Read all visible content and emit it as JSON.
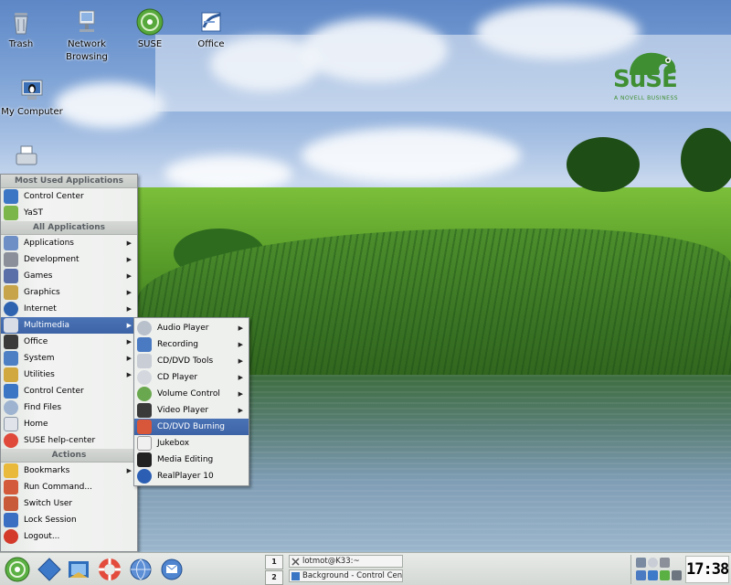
{
  "desktop": {
    "icons": [
      {
        "label": "Trash"
      },
      {
        "label": "Network Browsing"
      },
      {
        "label": "SUSE"
      },
      {
        "label": "Office"
      },
      {
        "label": "My Computer"
      }
    ],
    "branding": {
      "word": "SuSE",
      "tagline": "A NOVELL BUSINESS",
      "color": "#3f8f32"
    }
  },
  "kmenu": {
    "most_used_header": "Most Used Applications",
    "most_used": [
      {
        "label": "Control Center",
        "icon": "control-center-icon"
      },
      {
        "label": "YaST",
        "icon": "yast-icon"
      }
    ],
    "all_apps_header": "All Applications",
    "all_apps": [
      {
        "label": "Applications",
        "icon": "applications-icon",
        "has_submenu": true
      },
      {
        "label": "Development",
        "icon": "development-icon",
        "has_submenu": true
      },
      {
        "label": "Games",
        "icon": "games-icon",
        "has_submenu": true
      },
      {
        "label": "Graphics",
        "icon": "graphics-icon",
        "has_submenu": true
      },
      {
        "label": "Internet",
        "icon": "internet-icon",
        "has_submenu": true
      },
      {
        "label": "Multimedia",
        "icon": "multimedia-icon",
        "has_submenu": true,
        "active": true
      },
      {
        "label": "Office",
        "icon": "office-icon",
        "has_submenu": true
      },
      {
        "label": "System",
        "icon": "system-icon",
        "has_submenu": true
      },
      {
        "label": "Utilities",
        "icon": "utilities-icon",
        "has_submenu": true
      },
      {
        "label": "Control Center",
        "icon": "control-center-icon",
        "has_submenu": false
      },
      {
        "label": "Find Files",
        "icon": "find-files-icon",
        "has_submenu": false
      },
      {
        "label": "Home",
        "icon": "home-icon",
        "has_submenu": false
      },
      {
        "label": "SUSE help-center",
        "icon": "help-icon",
        "has_submenu": false
      }
    ],
    "actions_header": "Actions",
    "actions": [
      {
        "label": "Bookmarks",
        "icon": "bookmarks-icon",
        "has_submenu": true
      },
      {
        "label": "Run Command...",
        "icon": "run-command-icon",
        "has_submenu": false
      },
      {
        "label": "Switch User",
        "icon": "switch-user-icon",
        "has_submenu": false
      },
      {
        "label": "Lock Session",
        "icon": "lock-icon",
        "has_submenu": false
      },
      {
        "label": "Logout...",
        "icon": "logout-icon",
        "has_submenu": false
      }
    ]
  },
  "multimedia_submenu": {
    "items": [
      {
        "label": "Audio Player",
        "icon": "audio-player-icon",
        "has_submenu": true
      },
      {
        "label": "Recording",
        "icon": "recording-icon",
        "has_submenu": true
      },
      {
        "label": "CD/DVD Tools",
        "icon": "cd-dvd-tools-icon",
        "has_submenu": true
      },
      {
        "label": "CD Player",
        "icon": "cd-player-icon",
        "has_submenu": true
      },
      {
        "label": "Volume Control",
        "icon": "volume-icon",
        "has_submenu": true
      },
      {
        "label": "Video Player",
        "icon": "video-player-icon",
        "has_submenu": true
      },
      {
        "label": "CD/DVD Burning",
        "icon": "burning-icon",
        "has_submenu": false,
        "active": true
      },
      {
        "label": "Jukebox",
        "icon": "jukebox-icon",
        "has_submenu": false
      },
      {
        "label": "Media Editing",
        "icon": "media-editing-icon",
        "has_submenu": false
      },
      {
        "label": "RealPlayer 10",
        "icon": "realplayer-icon",
        "has_submenu": false
      }
    ]
  },
  "taskbar": {
    "desktops": [
      "1",
      "2"
    ],
    "tasks": [
      {
        "label": "lotmot@K33:~",
        "icon": "terminal-icon"
      },
      {
        "label": "Background - Control Cent",
        "icon": "control-center-icon"
      }
    ],
    "clock": "17:38"
  },
  "colors": {
    "menu_highlight": "#3c63a6",
    "menu_bg": "#eef0ee",
    "suse_green": "#3f8f32"
  }
}
